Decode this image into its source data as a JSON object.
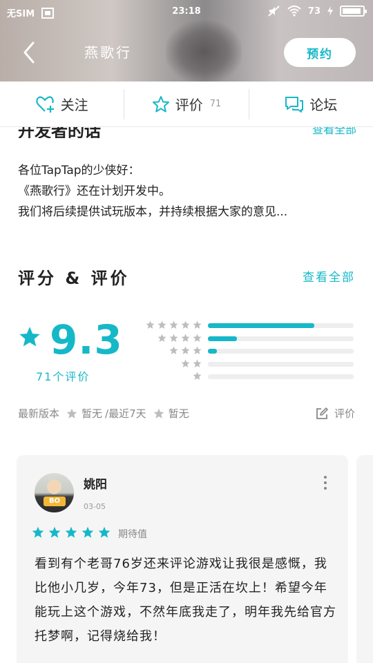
{
  "status_bar": {
    "carrier": "无SIM",
    "time": "23:18",
    "battery": "73"
  },
  "header": {
    "title": "燕歌行",
    "reserve_label": "预约"
  },
  "actions": {
    "follow_label": "关注",
    "review_label": "评价",
    "review_count": "71",
    "forum_label": "论坛"
  },
  "developer": {
    "title": "开发者的话",
    "more": "查看全部",
    "lines": [
      "各位TapTap的少侠好：",
      "《燕歌行》还在计划开发中。",
      "我们将后续提供试玩版本，并持续根据大家的意见..."
    ]
  },
  "rating": {
    "title": "评分 & 评价",
    "more": "查看全部",
    "score": "9.3",
    "count_label": "71个评价",
    "distribution": [
      {
        "stars": 5,
        "fraction": 0.73
      },
      {
        "stars": 4,
        "fraction": 0.2
      },
      {
        "stars": 3,
        "fraction": 0.06
      },
      {
        "stars": 2,
        "fraction": 0.0
      },
      {
        "stars": 1,
        "fraction": 0.0
      }
    ],
    "latest_version_label": "最新版本",
    "latest_version_value": "暂无",
    "recent_label": "/最近7天",
    "recent_value": "暂无",
    "write_review_label": "评价"
  },
  "review": {
    "user": "姚阳",
    "avatar_text": "BO",
    "date": "03-05",
    "stars": 5,
    "tag": "期待值",
    "text": "看到有个老哥76岁还来评论游戏让我很是感慨，我比他小几岁，今年73，但是正活在坎上！希望今年能玩上这个游戏，不然年底我走了，明年我先给官方托梦啊，记得烧给我！"
  },
  "colors": {
    "accent": "#16b8c8",
    "star_gray": "#bdbdbd",
    "text": "#222222"
  }
}
